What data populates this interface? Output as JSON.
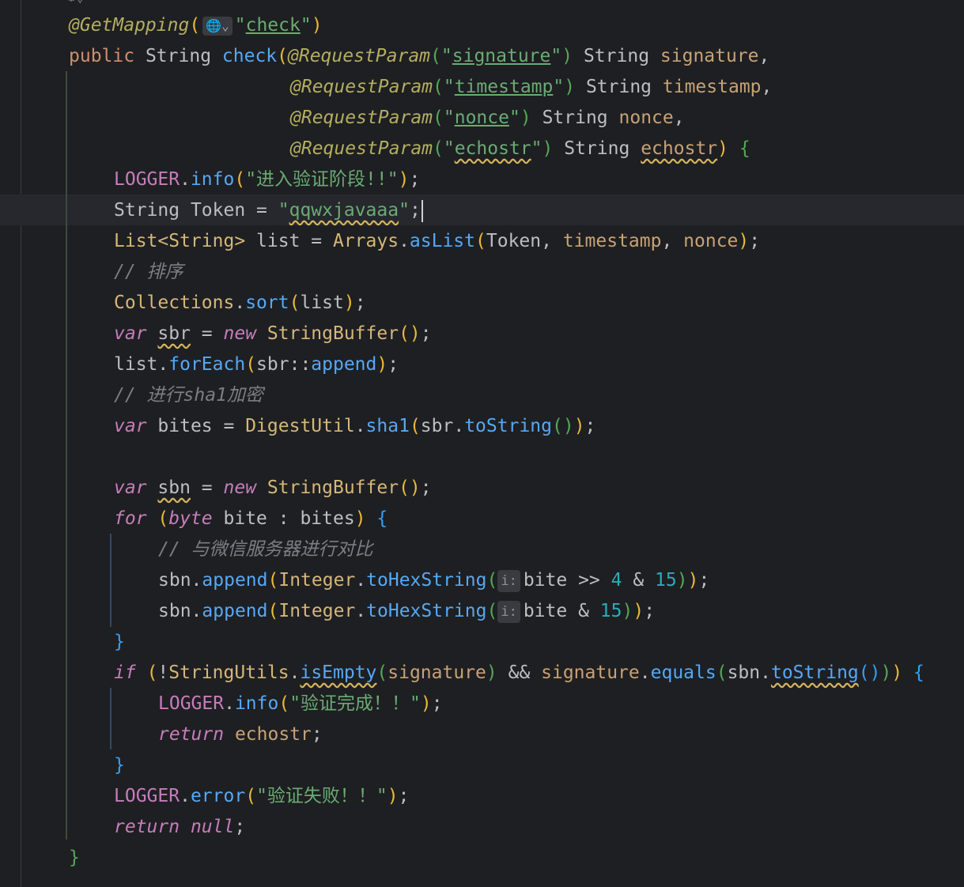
{
  "editor": {
    "language": "Java",
    "current_line_index": 6,
    "mapping_annotation": "@GetMapping",
    "mapping_path": "check",
    "method_signature": {
      "modifier": "public",
      "return_type": "String",
      "method_name": "check",
      "params": [
        {
          "annotation": "@RequestParam",
          "name_literal": "signature",
          "type": "String",
          "var": "signature",
          "tail": ","
        },
        {
          "annotation": "@RequestParam",
          "name_literal": "timestamp",
          "type": "String",
          "var": "timestamp",
          "tail": ","
        },
        {
          "annotation": "@RequestParam",
          "name_literal": "nonce",
          "type": "String",
          "var": "nonce",
          "tail": ","
        },
        {
          "annotation": "@RequestParam",
          "name_literal": "echostr",
          "type": "String",
          "var": "echostr",
          "tail": ")"
        }
      ]
    },
    "strings": {
      "log_enter": "\"进入验证阶段!!\"",
      "token_value": "qqwxjavaaa",
      "log_success": "\"验证完成！！\"",
      "log_error": "\"验证失败！！\""
    },
    "comments": {
      "sort": "// 排序",
      "sha1": "// 进行sha1加密",
      "compare": "// 与微信服务器进行对比"
    },
    "identifiers": {
      "logger": "LOGGER",
      "info": "info",
      "error": "error",
      "token": "Token",
      "list": "list",
      "arrays": "Arrays",
      "as_list": "asList",
      "collections": "Collections",
      "sort": "sort",
      "sbr": "sbr",
      "string_buffer": "StringBuffer",
      "for_each": "forEach",
      "append": "append",
      "bites": "bites",
      "digest_util": "DigestUtil",
      "sha1": "sha1",
      "to_string": "toString",
      "sbn": "sbn",
      "bite": "bite",
      "integer": "Integer",
      "to_hex_string": "toHexString",
      "string_utils": "StringUtils",
      "is_empty": "isEmpty",
      "equals": "equals",
      "list_type": "List<String>"
    },
    "keywords": {
      "var": "var",
      "new": "new",
      "for": "for",
      "byte": "byte",
      "if": "if",
      "return": "return",
      "null": "null",
      "string": "String"
    },
    "numbers": {
      "shift": "4",
      "mask": "15"
    },
    "inlay_hint": "i:"
  }
}
